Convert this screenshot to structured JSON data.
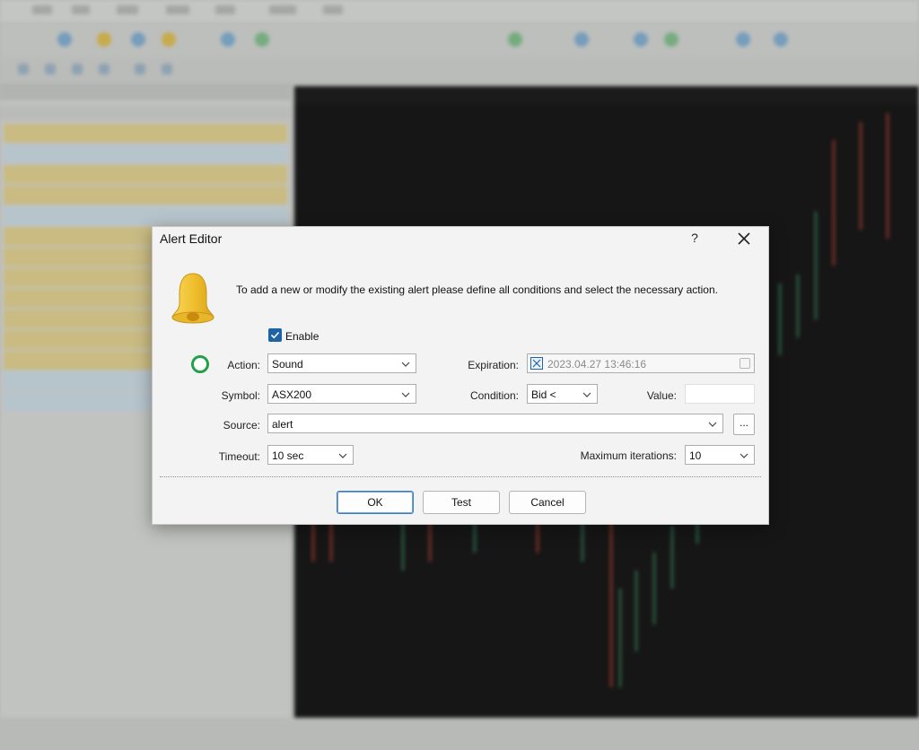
{
  "dialog": {
    "title": "Alert Editor",
    "help_glyph": "?",
    "description": "To add a new or modify the existing alert please define all conditions and select the necessary action.",
    "enable_label": "Enable",
    "enable_checked": true,
    "action": {
      "label": "Action:",
      "value": "Sound"
    },
    "expiration": {
      "label": "Expiration:",
      "value": "2023.04.27 13:46:16"
    },
    "symbol": {
      "label": "Symbol:",
      "value": "ASX200"
    },
    "condition": {
      "label": "Condition:",
      "value": "Bid <"
    },
    "value_field": {
      "label": "Value:",
      "value": ""
    },
    "source": {
      "label": "Source:",
      "value": "alert"
    },
    "browse_label": "...",
    "timeout": {
      "label": "Timeout:",
      "value": "10 sec"
    },
    "max_iterations": {
      "label": "Maximum iterations:",
      "value": "10"
    },
    "buttons": {
      "ok": "OK",
      "test": "Test",
      "cancel": "Cancel"
    }
  },
  "icons": [
    "bell-icon",
    "close-icon",
    "checkmark-icon",
    "chevron-down-icon",
    "calendar-icon",
    "status-ring-icon"
  ],
  "colors": {
    "accent": "#1e63a6",
    "status_green": "#22a04a",
    "bell_gold": "#f0c030",
    "dialog_bg": "#f3f3f3",
    "chart_bg": "#0c0c0c"
  }
}
